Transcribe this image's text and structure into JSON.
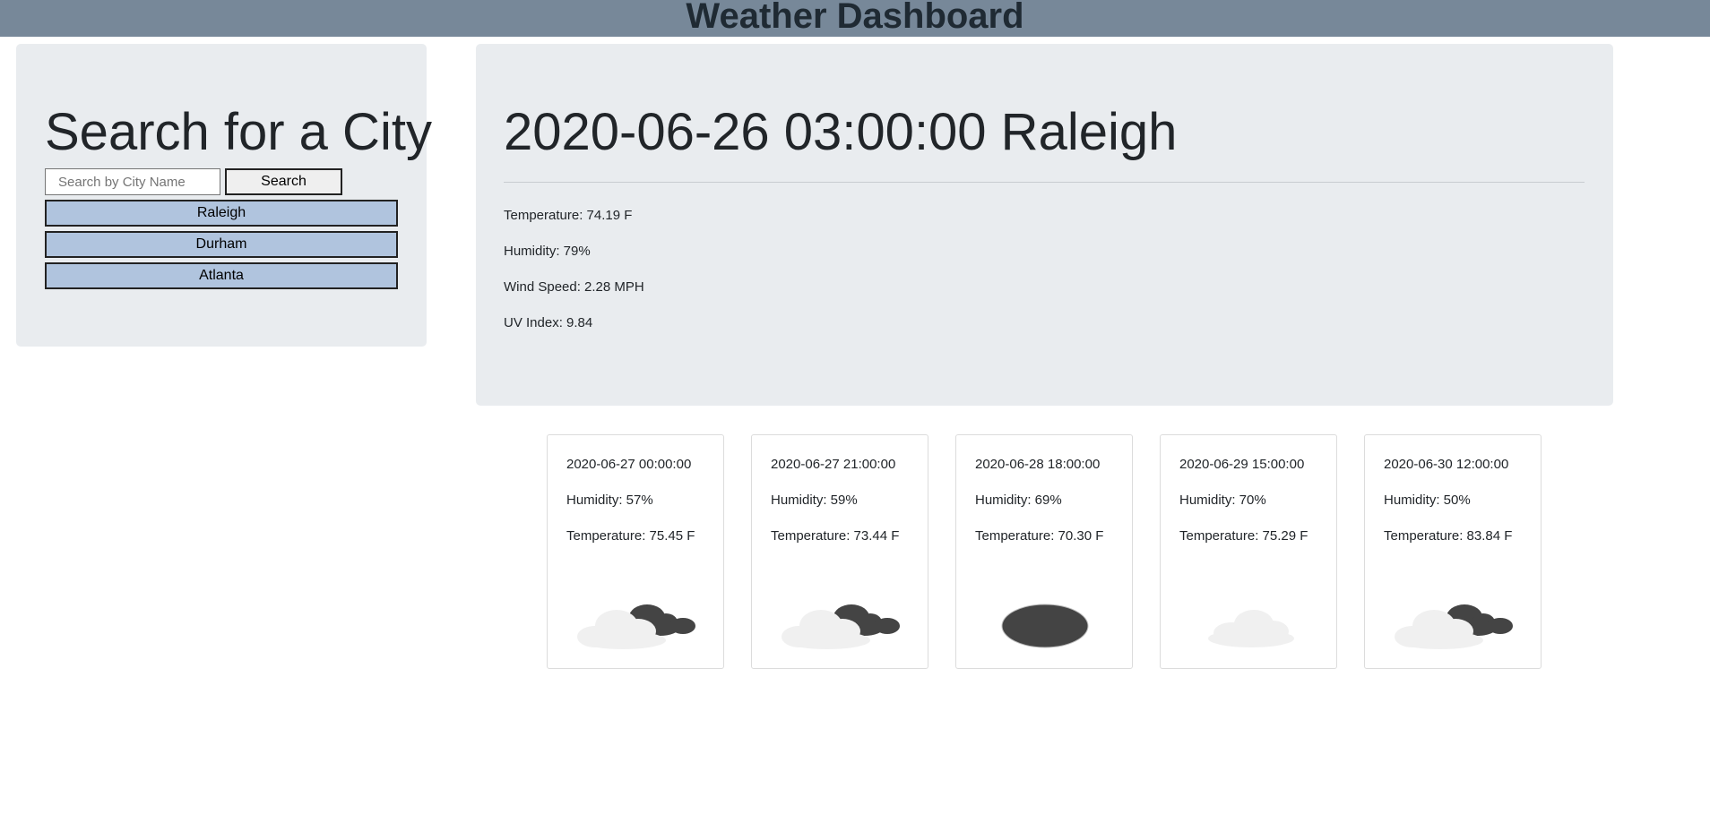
{
  "header": {
    "title": "Weather Dashboard"
  },
  "search": {
    "title": "Search for a City",
    "placeholder": "Search by City Name",
    "button_label": "Search",
    "history": [
      "Raleigh",
      "Durham",
      "Atlanta"
    ]
  },
  "current": {
    "title": "2020-06-26 03:00:00 Raleigh",
    "temperature": "Temperature: 74.19 F",
    "humidity": "Humidity: 79%",
    "wind": "Wind Speed: 2.28 MPH",
    "uv": "UV Index: 9.84"
  },
  "forecast": [
    {
      "date": "2020-06-27 00:00:00",
      "humidity": "Humidity: 57%",
      "temperature": "Temperature: 75.45 F",
      "icon": "broken-clouds-icon"
    },
    {
      "date": "2020-06-27 21:00:00",
      "humidity": "Humidity: 59%",
      "temperature": "Temperature: 73.44 F",
      "icon": "broken-clouds-icon"
    },
    {
      "date": "2020-06-28 18:00:00",
      "humidity": "Humidity: 69%",
      "temperature": "Temperature: 70.30 F",
      "icon": "overcast-clouds-icon"
    },
    {
      "date": "2020-06-29 15:00:00",
      "humidity": "Humidity: 70%",
      "temperature": "Temperature: 75.29 F",
      "icon": "few-clouds-icon"
    },
    {
      "date": "2020-06-30 12:00:00",
      "humidity": "Humidity: 50%",
      "temperature": "Temperature: 83.84 F",
      "icon": "broken-clouds-icon"
    }
  ],
  "colors": {
    "header_bg": "#778899",
    "panel_bg": "#e9ecef",
    "history_button_bg": "#b0c4de",
    "cloud_dark": "#444444",
    "cloud_light": "#f0f0f0"
  }
}
